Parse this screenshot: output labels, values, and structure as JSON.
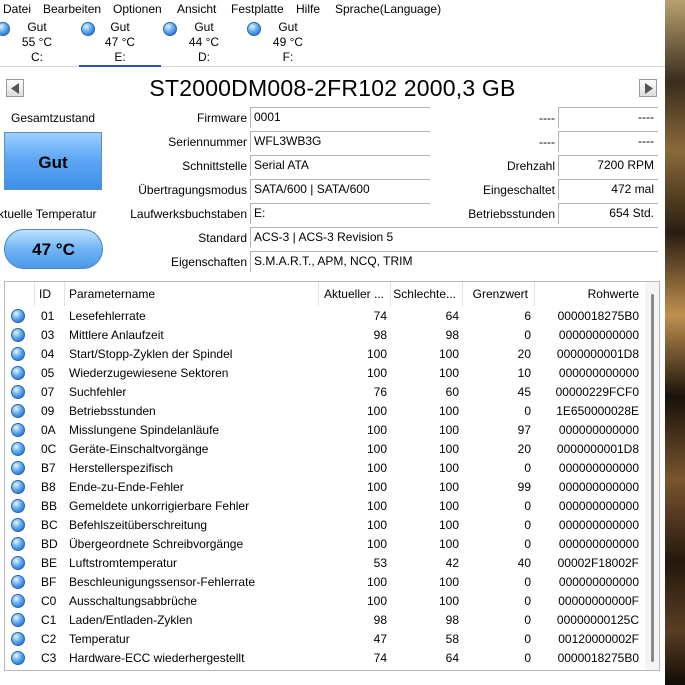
{
  "menu": [
    "Datei",
    "Bearbeiten",
    "Optionen",
    "Ansicht",
    "Festplatte",
    "Hilfe",
    "Sprache(Language)"
  ],
  "disks": [
    {
      "status": "Gut",
      "temp": "55 °C",
      "letter": "C:"
    },
    {
      "status": "Gut",
      "temp": "47 °C",
      "letter": "E:",
      "active": true
    },
    {
      "status": "Gut",
      "temp": "44 °C",
      "letter": "D:"
    },
    {
      "status": "Gut",
      "temp": "49 °C",
      "letter": "F:"
    }
  ],
  "title": "ST2000DM008-2FR102 2000,3 GB",
  "health": {
    "label": "Gesamtzustand",
    "value": "Gut"
  },
  "temperature": {
    "label": "Aktuelle Temperatur",
    "value": "47 °C"
  },
  "info": {
    "firmware": {
      "label": "Firmware",
      "value": "0001"
    },
    "serial": {
      "label": "Seriennummer",
      "value": "WFL3WB3G"
    },
    "interface": {
      "label": "Schnittstelle",
      "value": "Serial ATA"
    },
    "transfer": {
      "label": "Übertragungsmodus",
      "value": "SATA/600 | SATA/600"
    },
    "drive_letter": {
      "label": "Laufwerksbuchstaben",
      "value": "E:"
    },
    "standard": {
      "label": "Standard",
      "value": "ACS-3 | ACS-3 Revision 5"
    },
    "features": {
      "label": "Eigenschaften",
      "value": "S.M.A.R.T., APM, NCQ, TRIM"
    },
    "right_top1": {
      "label": "----",
      "value": "----"
    },
    "right_top2": {
      "label": "----",
      "value": "----"
    },
    "rpm": {
      "label": "Drehzahl",
      "value": "7200 RPM"
    },
    "power_on_count": {
      "label": "Eingeschaltet",
      "value": "472 mal"
    },
    "power_on_hours": {
      "label": "Betriebsstunden",
      "value": "654 Std."
    }
  },
  "table": {
    "headers": [
      "ID",
      "Parametername",
      "Aktueller ...",
      "Schlechte...",
      "Grenzwert",
      "Rohwerte"
    ],
    "rows": [
      [
        "01",
        "Lesefehlerrate",
        "74",
        "64",
        "6",
        "0000018275B0"
      ],
      [
        "03",
        "Mittlere Anlaufzeit",
        "98",
        "98",
        "0",
        "000000000000"
      ],
      [
        "04",
        "Start/Stopp-Zyklen der Spindel",
        "100",
        "100",
        "20",
        "0000000001D8"
      ],
      [
        "05",
        "Wiederzugewiesene Sektoren",
        "100",
        "100",
        "10",
        "000000000000"
      ],
      [
        "07",
        "Suchfehler",
        "76",
        "60",
        "45",
        "00000229FCF0"
      ],
      [
        "09",
        "Betriebsstunden",
        "100",
        "100",
        "0",
        "1E650000028E"
      ],
      [
        "0A",
        "Misslungene Spindelanläufe",
        "100",
        "100",
        "97",
        "000000000000"
      ],
      [
        "0C",
        "Geräte-Einschaltvorgänge",
        "100",
        "100",
        "20",
        "0000000001D8"
      ],
      [
        "B7",
        "Herstellerspezifisch",
        "100",
        "100",
        "0",
        "000000000000"
      ],
      [
        "B8",
        "Ende-zu-Ende-Fehler",
        "100",
        "100",
        "99",
        "000000000000"
      ],
      [
        "BB",
        "Gemeldete unkorrigierbare Fehler",
        "100",
        "100",
        "0",
        "000000000000"
      ],
      [
        "BC",
        "Befehlszeitüberschreitung",
        "100",
        "100",
        "0",
        "000000000000"
      ],
      [
        "BD",
        "Übergeordnete Schreibvorgänge",
        "100",
        "100",
        "0",
        "000000000000"
      ],
      [
        "BE",
        "Luftstromtemperatur",
        "53",
        "42",
        "40",
        "00002F18002F"
      ],
      [
        "BF",
        "Beschleunigungssensor-Fehlerrate",
        "100",
        "100",
        "0",
        "000000000000"
      ],
      [
        "C0",
        "Ausschaltungsabbrüche",
        "100",
        "100",
        "0",
        "00000000000F"
      ],
      [
        "C1",
        "Laden/Entladen-Zyklen",
        "98",
        "98",
        "0",
        "00000000125C"
      ],
      [
        "C2",
        "Temperatur",
        "47",
        "58",
        "0",
        "00120000002F"
      ],
      [
        "C3",
        "Hardware-ECC wiederhergestellt",
        "74",
        "64",
        "0",
        "0000018275B0"
      ]
    ]
  },
  "colors": {
    "accent": "#3050c0",
    "orb": "#3a86e0",
    "health_bg": "#5ea8f4"
  },
  "icons": {
    "prev": "left-triangle-icon",
    "next": "right-triangle-icon",
    "status": "blue-orb-icon"
  }
}
